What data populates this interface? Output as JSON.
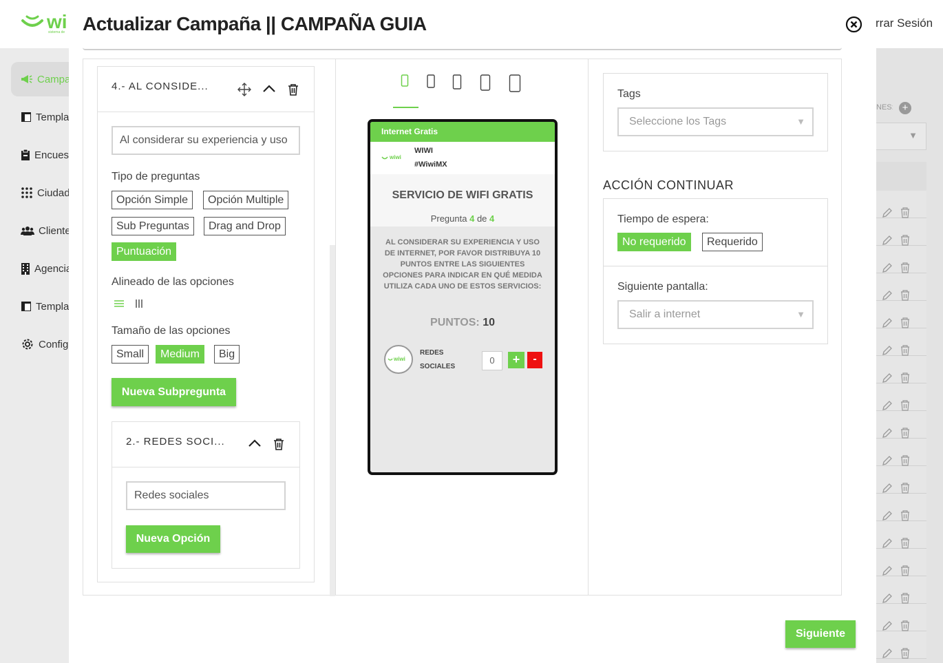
{
  "app": {
    "logo_text": "wi",
    "logo_subtitle": "sistema de",
    "logout_label": "rrar Sesión"
  },
  "sidebar": {
    "items": [
      {
        "label": "Campañas",
        "icon": "megaphone-icon",
        "active": true
      },
      {
        "label": "Templates",
        "icon": "template-icon"
      },
      {
        "label": "Encuestas",
        "icon": "clipboard-icon"
      },
      {
        "label": "Ciudades",
        "icon": "grid-dots-icon"
      },
      {
        "label": "Clientes",
        "icon": "users-icon"
      },
      {
        "label": "Agencias",
        "icon": "building-icon"
      },
      {
        "label": "Templates",
        "icon": "template-icon"
      },
      {
        "label": "Configuración",
        "icon": "gear-icon"
      }
    ]
  },
  "background_table": {
    "filter_label": "NES:",
    "add_symbol": "+"
  },
  "modal": {
    "title": "Actualizar Campaña || CAMPAÑA GUIA",
    "question": {
      "title": "4.- AL CONSIDE...",
      "text_value": "Al considerar su experiencia y uso",
      "type_label": "Tipo de preguntas",
      "types": [
        "Opción Simple",
        "Opción Multiple",
        "Sub Preguntas",
        "Drag and Drop",
        "Puntuación"
      ],
      "selected_type": "Puntuación",
      "align_label": "Alineado de las opciones",
      "size_label": "Tamaño de las opciones",
      "sizes": [
        "Small",
        "Medium",
        "Big"
      ],
      "selected_size": "Medium",
      "new_subquestion_label": "Nueva Subpregunta"
    },
    "subquestion": {
      "title": "2.- REDES SOCI...",
      "text_value": "Redes sociales",
      "new_option_label": "Nueva Opción"
    },
    "preview": {
      "devices": [
        "phone-small",
        "phone",
        "phone-medium",
        "tablet",
        "tablet-large"
      ],
      "header": "Internet Gratis",
      "brand_name": "WIWI",
      "brand_handle": "#WiwiMX",
      "logo_text": "wiwi",
      "heading": "SERVICIO DE WIFI GRATIS",
      "progress_prefix": "Pregunta",
      "progress_current": "4",
      "progress_sep": "de",
      "progress_total": "4",
      "question_text": "AL CONSIDERAR SU EXPERIENCIA Y USO DE INTERNET, POR FAVOR DISTRIBUYA 10 PUNTOS ENTRE LAS SIGUIENTES OPCIONES PARA INDICAR EN QUÉ MEDIDA UTILIZA CADA UNO DE ESTOS SERVICIOS:",
      "points_label": "PUNTOS:",
      "points_value": "10",
      "option_line1": "REDES",
      "option_line2": "SOCIALES",
      "option_value": "0",
      "plus": "+",
      "minus": "-"
    },
    "settings": {
      "tags_label": "Tags",
      "tags_placeholder": "Seleccione los Tags",
      "action_heading": "ACCIÓN CONTINUAR",
      "wait_label": "Tiempo de espera:",
      "wait_options": [
        "No requerido",
        "Requerido"
      ],
      "wait_selected": "No requerido",
      "next_screen_label": "Siguiente pantalla:",
      "next_screen_value": "Salir a internet"
    },
    "next_button": "Siguiente"
  },
  "colors": {
    "accent": "#6ed04c",
    "danger": "#ee1111",
    "text": "#333333"
  }
}
